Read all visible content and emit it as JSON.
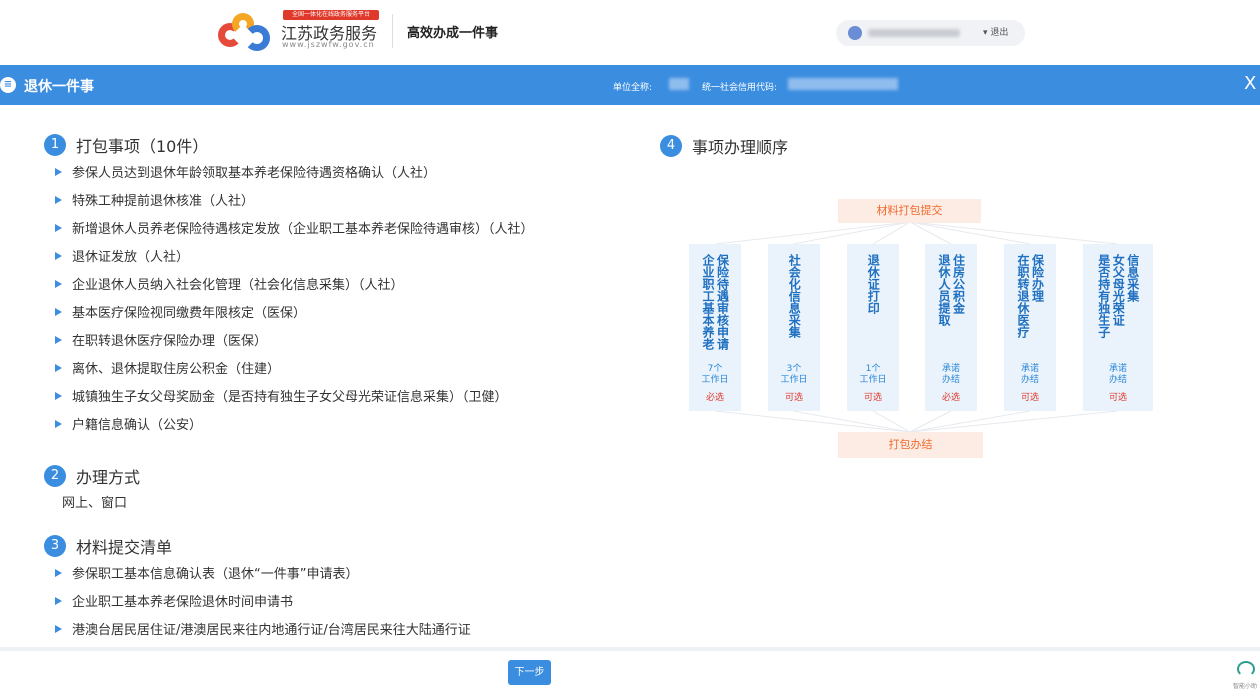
{
  "header": {
    "badge": "全国一体化在线政务服务平台",
    "brand_name": "江苏政务服务",
    "brand_url": "www.jszwfw.gov.cn",
    "slogan": "高效办成一件事",
    "caret": "▾",
    "logout": "退出"
  },
  "titlebar": {
    "icon": "list-icon",
    "title": "退休一件事",
    "unit_label": "单位全称:",
    "credit_label": "统一社会信用代码:",
    "close": "X"
  },
  "sections": {
    "s1": {
      "num": "1",
      "title": "打包事项（10件）"
    },
    "s2": {
      "num": "2",
      "title": "办理方式"
    },
    "s3": {
      "num": "3",
      "title": "材料提交清单"
    },
    "s4": {
      "num": "4",
      "title": "事项办理顺序"
    }
  },
  "items": [
    "参保人员达到退休年龄领取基本养老保险待遇资格确认（人社）",
    "特殊工种提前退休核准（人社）",
    "新增退休人员养老保险待遇核定发放（企业职工基本养老保险待遇审核）（人社）",
    "退休证发放（人社）",
    "企业退休人员纳入社会化管理（社会化信息采集）（人社）",
    "基本医疗保险视同缴费年限核定（医保）",
    "在职转退休医疗保险办理（医保）",
    "离休、退休提取住房公积金（住建）",
    "城镇独生子女父母奖励金（是否持有独生子女父母光荣证信息采集）（卫健）",
    "户籍信息确认（公安）"
  ],
  "method": "网上、窗口",
  "materials": [
    "参保职工基本信息确认表（退休“一件事”申请表）",
    "企业职工基本养老保险退休时间申请书",
    "港澳台居民居住证/港澳居民来往内地通行证/台湾居民来往大陆通行证"
  ],
  "flow": {
    "top": "材料打包提交",
    "bottom": "打包办结",
    "columns": [
      {
        "lines": [
          "企业职工基本养老",
          "保险待遇审核申请"
        ],
        "days": "7个\n工作日",
        "req": "必选"
      },
      {
        "lines": [
          "社会化信息采集"
        ],
        "days": "3个\n工作日",
        "req": "可选"
      },
      {
        "lines": [
          "退休证打印"
        ],
        "days": "1个\n工作日",
        "req": "可选"
      },
      {
        "lines": [
          "退休人员提取",
          "住房公积金"
        ],
        "days": "承诺\n办结",
        "req": "必选"
      },
      {
        "lines": [
          "在职转退休医疗",
          "保险办理"
        ],
        "days": "承诺\n办结",
        "req": "可选"
      },
      {
        "lines": [
          "是否持有独生子",
          "女父母光荣证",
          "信息采集"
        ],
        "days": "承诺\n办结",
        "req": "可选"
      }
    ]
  },
  "footer": {
    "next": "下一步",
    "assistant": "智能小助"
  }
}
